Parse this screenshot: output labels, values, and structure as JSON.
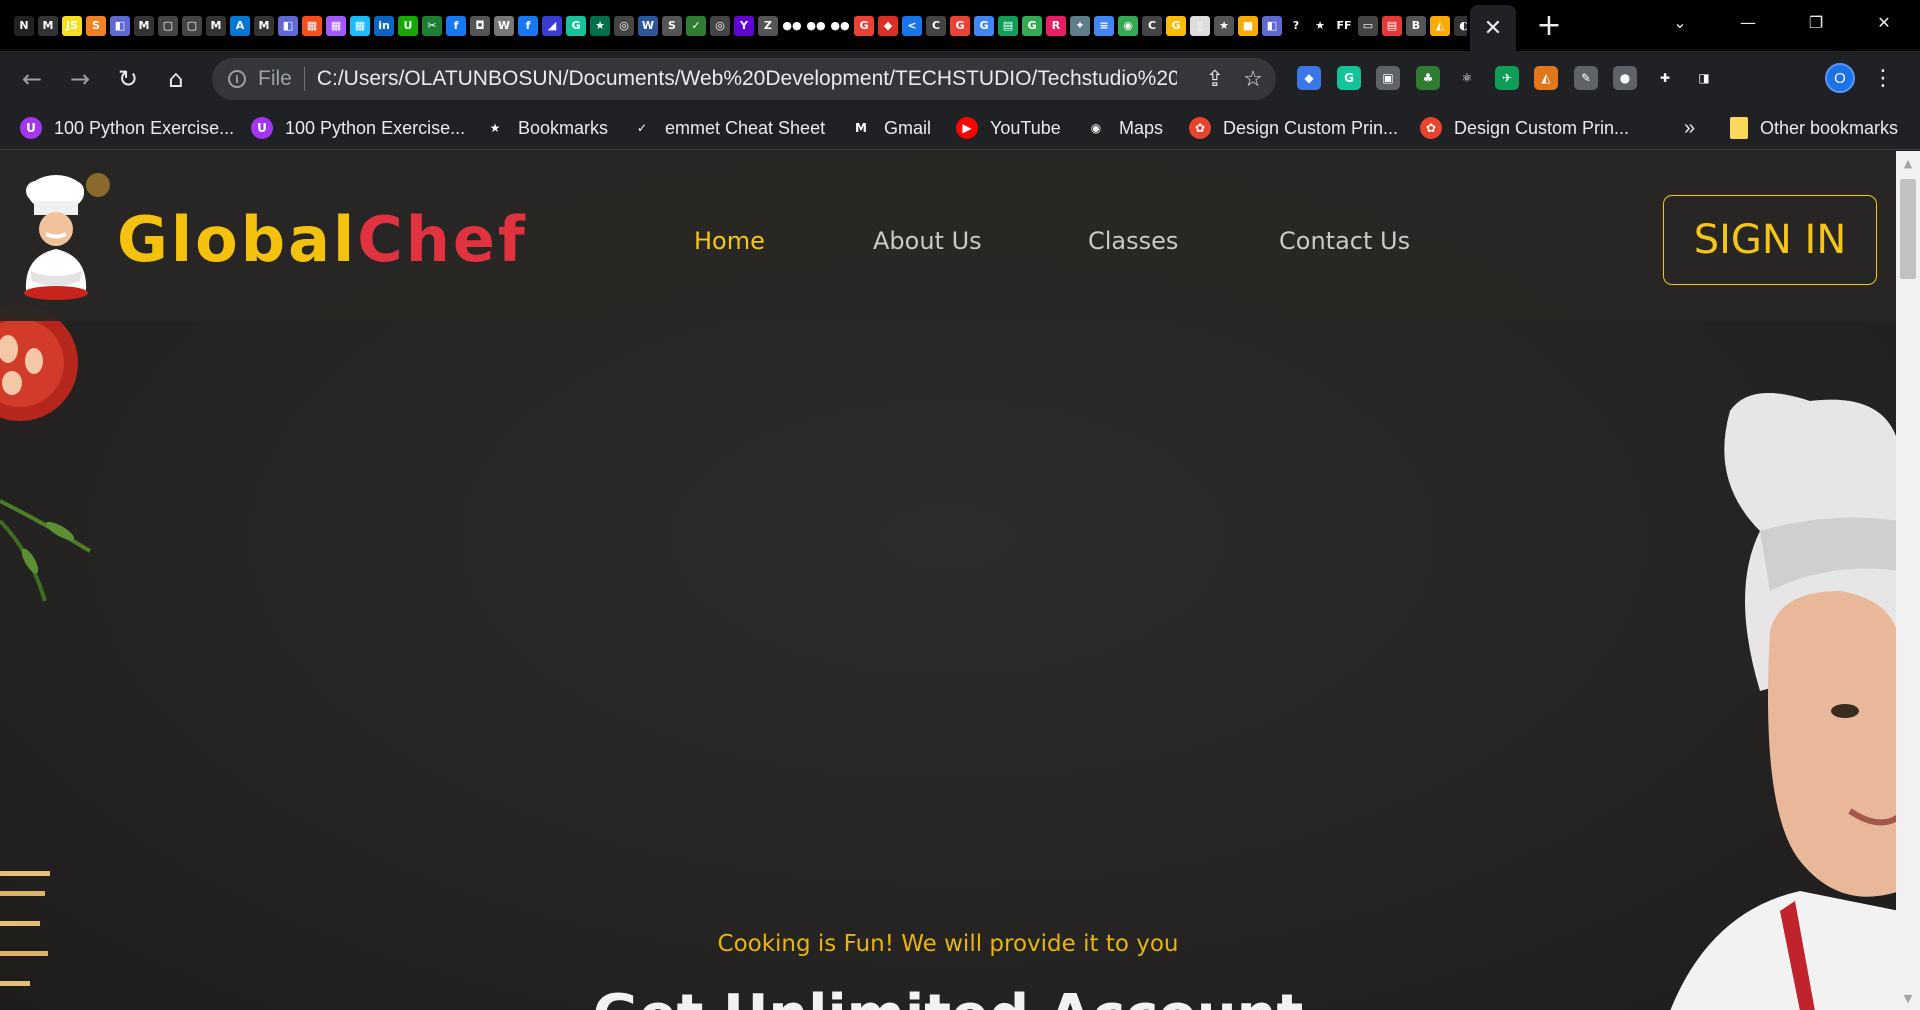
{
  "browser": {
    "tab_close_label": "✕",
    "new_tab_label": "+",
    "window_controls": {
      "tab_search": "⌄",
      "minimize": "—",
      "restore": "❐",
      "close": "✕"
    },
    "tab_favicons": [
      {
        "name": "notion-icon",
        "color": "#222222",
        "glyph": "N"
      },
      {
        "name": "medium-icon",
        "color": "#333333",
        "glyph": "M"
      },
      {
        "name": "javascript-icon",
        "color": "#f7df1e",
        "glyph": "JS"
      },
      {
        "name": "stackoverflow-icon",
        "color": "#f48024",
        "glyph": "S"
      },
      {
        "name": "linear-icon",
        "color": "#5e6ad2",
        "glyph": "◧"
      },
      {
        "name": "medium-icon",
        "color": "#333333",
        "glyph": "M"
      },
      {
        "name": "page-icon",
        "color": "#444444",
        "glyph": "▢"
      },
      {
        "name": "page-icon",
        "color": "#444444",
        "glyph": "▢"
      },
      {
        "name": "medium-icon",
        "color": "#333333",
        "glyph": "M"
      },
      {
        "name": "azure-icon",
        "color": "#0078d4",
        "glyph": "A"
      },
      {
        "name": "medium-icon",
        "color": "#333333",
        "glyph": "M"
      },
      {
        "name": "linear-icon",
        "color": "#5e6ad2",
        "glyph": "◧"
      },
      {
        "name": "figma-icon",
        "color": "#f24e1e",
        "glyph": "▦"
      },
      {
        "name": "figma-icon",
        "color": "#a259ff",
        "glyph": "▦"
      },
      {
        "name": "figma-icon",
        "color": "#1abcfe",
        "glyph": "▦"
      },
      {
        "name": "linkedin-icon",
        "color": "#0a66c2",
        "glyph": "in"
      },
      {
        "name": "upwork-icon",
        "color": "#14a800",
        "glyph": "U"
      },
      {
        "name": "sketch-icon",
        "color": "#1e7e34",
        "glyph": "✂"
      },
      {
        "name": "facebook-icon",
        "color": "#1877f2",
        "glyph": "f"
      },
      {
        "name": "page-icon",
        "color": "#555555",
        "glyph": "◘"
      },
      {
        "name": "wikipedia-icon",
        "color": "#777777",
        "glyph": "W"
      },
      {
        "name": "facebook-icon",
        "color": "#1877f2",
        "glyph": "f"
      },
      {
        "name": "page-icon",
        "color": "#3b3bd1",
        "glyph": "◢"
      },
      {
        "name": "grammarly-icon",
        "color": "#15c39a",
        "glyph": "G"
      },
      {
        "name": "starbucks-icon",
        "color": "#00704a",
        "glyph": "★"
      },
      {
        "name": "github-icon",
        "color": "#444444",
        "glyph": "◎"
      },
      {
        "name": "word-icon",
        "color": "#2b579a",
        "glyph": "W"
      },
      {
        "name": "scribd-icon",
        "color": "#555555",
        "glyph": "S"
      },
      {
        "name": "page-icon",
        "color": "#2e7d32",
        "glyph": "✓"
      },
      {
        "name": "github-icon",
        "color": "#444444",
        "glyph": "◎"
      },
      {
        "name": "yahoo-icon",
        "color": "#6001d2",
        "glyph": "Y"
      },
      {
        "name": "page-icon",
        "color": "#555555",
        "glyph": "Z"
      },
      {
        "name": "medium-icon",
        "color": "#000000",
        "glyph": "●●"
      },
      {
        "name": "medium-icon",
        "color": "#000000",
        "glyph": "●●"
      },
      {
        "name": "medium-icon",
        "color": "#000000",
        "glyph": "●●"
      },
      {
        "name": "google-icon",
        "color": "#ea4335",
        "glyph": "G"
      },
      {
        "name": "page-icon",
        "color": "#d93025",
        "glyph": "◆"
      },
      {
        "name": "page-icon",
        "color": "#1a73e8",
        "glyph": "<"
      },
      {
        "name": "page-icon",
        "color": "#444444",
        "glyph": "C"
      },
      {
        "name": "google-icon",
        "color": "#ea4335",
        "glyph": "G"
      },
      {
        "name": "google-icon",
        "color": "#4285f4",
        "glyph": "G"
      },
      {
        "name": "sheets-icon",
        "color": "#0f9d58",
        "glyph": "▤"
      },
      {
        "name": "google-icon",
        "color": "#34a853",
        "glyph": "G"
      },
      {
        "name": "page-icon",
        "color": "#e91e63",
        "glyph": "R"
      },
      {
        "name": "page-icon",
        "color": "#607d8b",
        "glyph": "✦"
      },
      {
        "name": "docs-icon",
        "color": "#4285f4",
        "glyph": "≡"
      },
      {
        "name": "maps-icon",
        "color": "#34a853",
        "glyph": "◉"
      },
      {
        "name": "page-icon",
        "color": "#444444",
        "glyph": "C"
      },
      {
        "name": "google-icon",
        "color": "#fbbc05",
        "glyph": "G"
      },
      {
        "name": "page-icon",
        "color": "#dddddd",
        "glyph": "▯"
      },
      {
        "name": "star-icon",
        "color": "#555555",
        "glyph": "★"
      },
      {
        "name": "page-icon",
        "color": "#f9ab00",
        "glyph": "■"
      },
      {
        "name": "linear-icon",
        "color": "#5e6ad2",
        "glyph": "◧"
      },
      {
        "name": "help-icon",
        "color": "#000000",
        "glyph": "?"
      },
      {
        "name": "star-icon",
        "color": "#000000",
        "glyph": "★"
      },
      {
        "name": "page-icon",
        "color": "#000000",
        "glyph": "FF"
      },
      {
        "name": "page-icon",
        "color": "#444444",
        "glyph": "▭"
      },
      {
        "name": "pdf-icon",
        "color": "#e53935",
        "glyph": "▤"
      },
      {
        "name": "bold-icon",
        "color": "#555555",
        "glyph": "B"
      },
      {
        "name": "page-icon",
        "color": "#f9ab00",
        "glyph": "◭"
      },
      {
        "name": "page-icon",
        "color": "#333333",
        "glyph": "◐"
      }
    ]
  },
  "toolbar": {
    "back": "←",
    "forward": "→",
    "reload": "↻",
    "home": "⌂",
    "info": "i",
    "file_label": "File",
    "url": "C:/Users/OLATUNBOSUN/Documents/Web%20Development/TECHSTUDIO/Techstudio%20...",
    "share": "⇪",
    "bookmark_star": "☆",
    "extensions": [
      {
        "name": "extension-icon-1",
        "color": "#3b78e7",
        "glyph": "◆"
      },
      {
        "name": "grammarly-icon",
        "color": "#15c39a",
        "glyph": "G"
      },
      {
        "name": "extension-icon-2",
        "color": "#5f6368",
        "glyph": "▣"
      },
      {
        "name": "tree-icon",
        "color": "#2e7d32",
        "glyph": "♣"
      },
      {
        "name": "react-icon",
        "color": "#202124",
        "glyph": "⚛"
      },
      {
        "name": "extension-icon-3",
        "color": "#0f9d58",
        "glyph": "✈"
      },
      {
        "name": "metamask-icon",
        "color": "#e2761b",
        "glyph": "◭"
      },
      {
        "name": "extension-icon-4",
        "color": "#5f6368",
        "glyph": "✎"
      },
      {
        "name": "extension-icon-5",
        "color": "#5f6368",
        "glyph": "●"
      },
      {
        "name": "extensions-puzzle-icon",
        "color": "#202124",
        "glyph": "✚"
      },
      {
        "name": "side-panel-icon",
        "color": "#202124",
        "glyph": "◨"
      }
    ],
    "profile_initial": "O",
    "menu": "⋮"
  },
  "bookmarks": {
    "items": [
      {
        "label": "100 Python Exercise...",
        "icon": "udemy-icon",
        "color": "#a435f0",
        "glyph": "U"
      },
      {
        "label": "100 Python Exercise...",
        "icon": "udemy-icon",
        "color": "#a435f0",
        "glyph": "U"
      },
      {
        "label": "Bookmarks",
        "icon": "star-icon",
        "color": "#202124",
        "glyph": "★"
      },
      {
        "label": "emmet Cheat Sheet",
        "icon": "emmet-icon",
        "color": "#202124",
        "glyph": "✓"
      },
      {
        "label": "Gmail",
        "icon": "gmail-icon",
        "color": "#202124",
        "glyph": "M"
      },
      {
        "label": "YouTube",
        "icon": "youtube-icon",
        "color": "#ff0000",
        "glyph": "▶"
      },
      {
        "label": "Maps",
        "icon": "maps-pin-icon",
        "color": "#202124",
        "glyph": "◉"
      },
      {
        "label": "Design Custom Prin...",
        "icon": "design-icon",
        "color": "#e8442b",
        "glyph": "✿"
      },
      {
        "label": "Design Custom Prin...",
        "icon": "design-icon",
        "color": "#e8442b",
        "glyph": "✿"
      }
    ],
    "overflow": "»",
    "other": "Other bookmarks"
  },
  "site": {
    "brand_part1": "Global",
    "brand_part2": "Chef",
    "nav": [
      {
        "label": "Home",
        "active": true
      },
      {
        "label": "About Us",
        "active": false
      },
      {
        "label": "Classes",
        "active": false
      },
      {
        "label": "Contact Us",
        "active": false
      }
    ],
    "signin_label": "SIGN IN",
    "hero_tagline": "Cooking is Fun! We will provide it to you",
    "hero_title": "Get Unlimited Account"
  },
  "colors": {
    "accent_yellow": "#f5c518",
    "brand_red": "#e0323f",
    "page_background": "#262523"
  }
}
